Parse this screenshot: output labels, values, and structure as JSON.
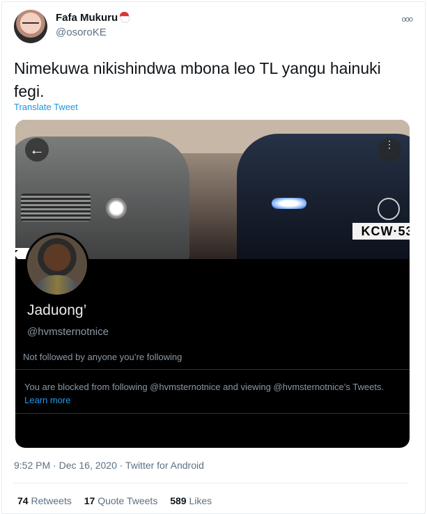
{
  "author": {
    "name": "Fafa Mukuru",
    "handle": "@osoroKE"
  },
  "more_label": "ooo",
  "tweet_text": "Nimekuwa nikishindwa mbona leo TL yangu hainuki fegi.",
  "translate_label": "Translate Tweet",
  "card": {
    "plate_left": "K",
    "plate_right": "KCW·53",
    "profile_name": "Jaduong’",
    "profile_handle": "@hvmsternotnice",
    "not_followed": "Not followed by anyone you’re following",
    "blocked_text": "You are blocked from following @hvmsternotnice and viewing @hvmsternotnice’s Tweets.",
    "learn_more": "Learn more",
    "back_icon": "←",
    "menu_icon": "⋮"
  },
  "meta": "9:52 PM · Dec 16, 2020 · Twitter for Android",
  "stats": {
    "retweets_count": "74",
    "retweets_label": "Retweets",
    "quotes_count": "17",
    "quotes_label": "Quote Tweets",
    "likes_count": "589",
    "likes_label": "Likes"
  },
  "colors": {
    "link": "#1b95e0",
    "card_bg": "#000000",
    "muted": "#5b7083"
  }
}
